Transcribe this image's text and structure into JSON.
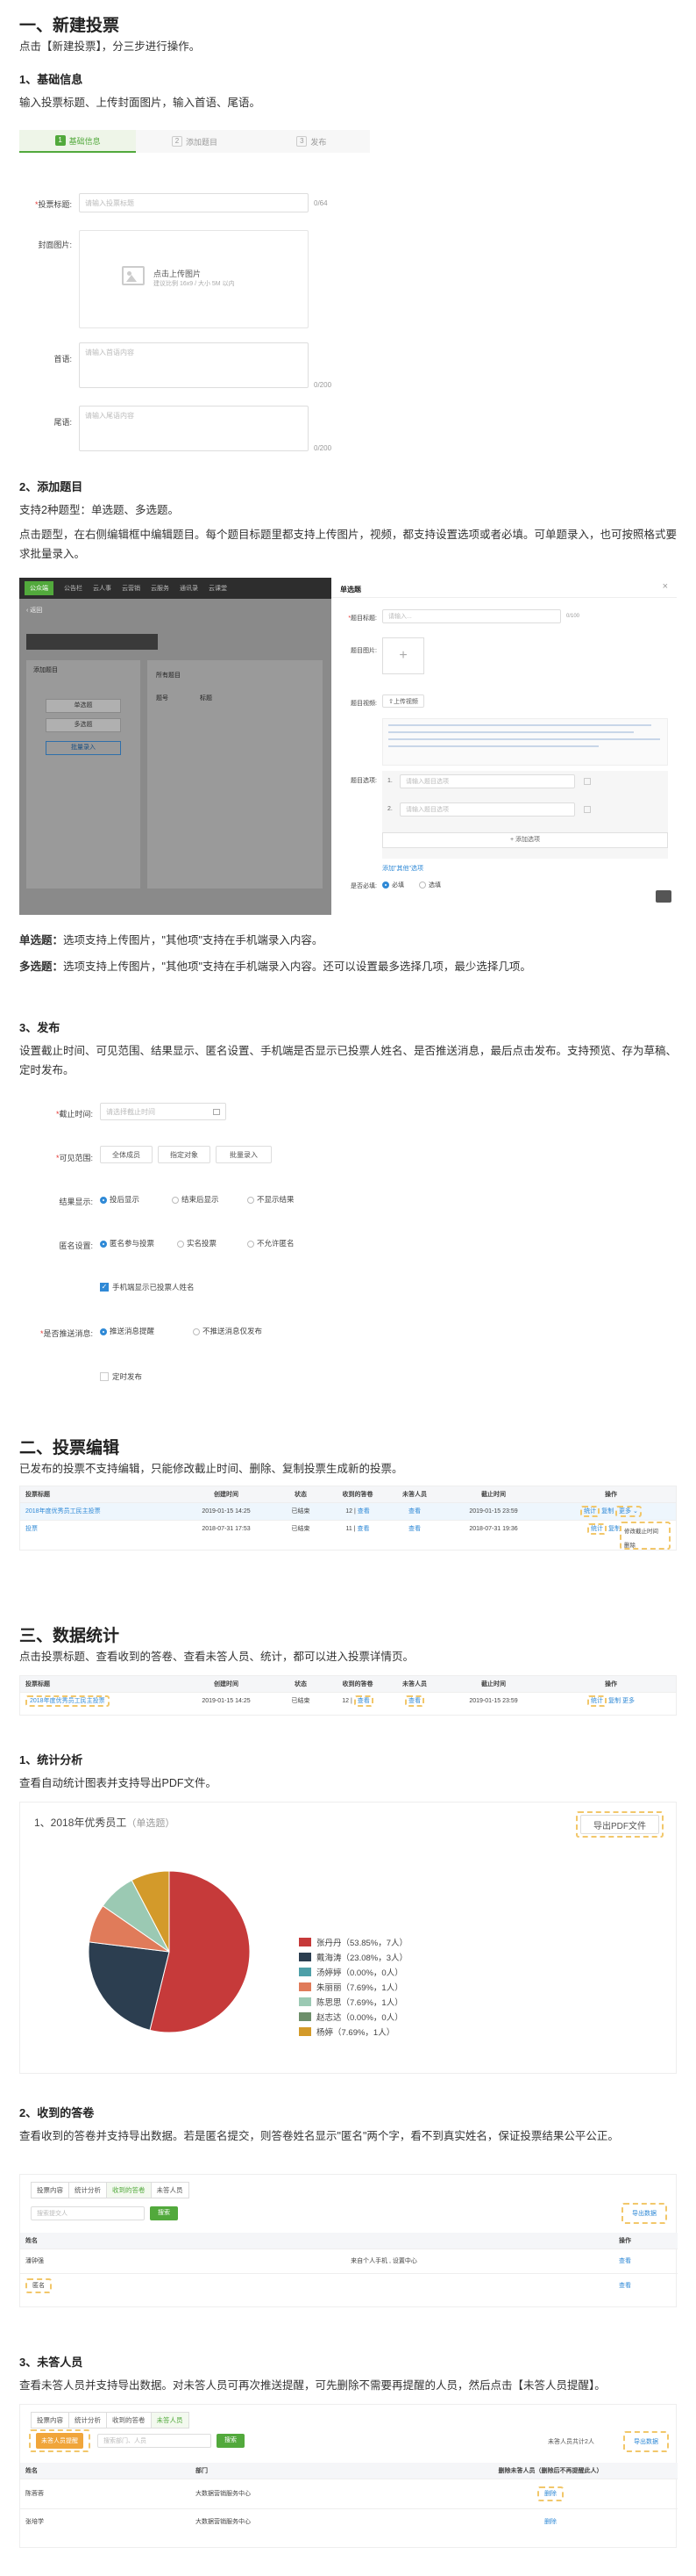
{
  "s1": {
    "title": "一、新建投票",
    "intro": "点击【新建投票】，分三步进行操作。",
    "h_basic": "1、基础信息",
    "basic_desc": "输入投票标题、上传封面图片，输入首语、尾语。",
    "steps": [
      {
        "num": "1",
        "label": "基础信息"
      },
      {
        "num": "2",
        "label": "添加题目"
      },
      {
        "num": "3",
        "label": "发布"
      }
    ],
    "form": {
      "title_label": "投票标题:",
      "title_ph": "请输入投票标题",
      "title_count": "0/64",
      "cover_label": "封面图片:",
      "upload_text": "点击上传图片",
      "upload_hint": "建议比例 16x9 / 大小 5M 以内",
      "head_label": "首语:",
      "head_ph": "请输入首语内容",
      "head_count": "0/200",
      "tail_label": "尾语:",
      "tail_ph": "请输入尾语内容",
      "tail_count": "0/200"
    },
    "h_add": "2、添加题目",
    "add_desc1": "支持2种题型：单选题、多选题。",
    "add_desc2": "点击题型，在右侧编辑框中编辑题目。每个题目标题里都支持上传图片，视频，都支持设置选项或者必填。可单题录入，也可按照格式要求批量录入。",
    "q_shot": {
      "nav": [
        "公众端",
        "公告栏",
        "云人事",
        "云营销",
        "云服务",
        "通讯录",
        "云课堂"
      ],
      "back": "返回",
      "panel_title": "添加题目",
      "types": [
        "单选题",
        "多选题"
      ],
      "batch": "批量录入",
      "list_title": "所有题目",
      "cols": [
        "题号",
        "标题"
      ],
      "modal_title": "单选题",
      "q_label": "题目标题:",
      "q_ph": "请输入...",
      "q_count": "0/100",
      "img_label": "题目图片:",
      "video_label": "题目视频:",
      "video_btn": "上传视频",
      "opt_label": "题目选项:",
      "opt1": "请输入题目选项",
      "opt2": "请输入题目选项",
      "add_opt": "+ 添加选项",
      "other": "添加\"其他\"选项",
      "req_label": "是否必填:",
      "req_yes": "必填",
      "req_no": "选填"
    },
    "single_b": "单选题：",
    "single_t": "选项支持上传图片，\"其他项\"支持在手机端录入内容。",
    "multi_b": "多选题：",
    "multi_t": "选项支持上传图片，\"其他项\"支持在手机端录入内容。还可以设置最多选择几项，最少选择几项。",
    "h_pub": "3、发布",
    "pub_desc": "设置截止时间、可见范围、结果显示、匿名设置、手机端是否显示已投票人姓名、是否推送消息，最后点击发布。支持预览、存为草稿、定时发布。",
    "pub": {
      "deadline": "截止时间:",
      "deadline_ph": "请选择截止时间",
      "scope": "可见范围:",
      "scope_opts": [
        "全体成员",
        "指定对象",
        "批量录入"
      ],
      "result": "结果显示:",
      "result_opts": [
        "投后显示",
        "结束后显示",
        "不显示结果"
      ],
      "anon": "匿名设置:",
      "anon_opts": [
        "匿名参与投票",
        "实名投票",
        "不允许匿名"
      ],
      "show_names": "手机端显示已投票人姓名",
      "push": "是否推送消息:",
      "push_opts": [
        "推送消息提醒",
        "不推送消息仅发布"
      ],
      "timed": "定时发布"
    }
  },
  "s2": {
    "title": "二、投票编辑",
    "desc": "已发布的投票不支持编辑，只能修改截止时间、删除、复制投票生成新的投票。",
    "cols": [
      "投票标题",
      "创建时间",
      "状态",
      "收到的答卷",
      "未答人员",
      "截止时间",
      "操作"
    ],
    "rows": [
      {
        "title": "2018年度优秀员工民主投票",
        "created": "2019-01-15 14:25",
        "status": "已结束",
        "count": "12",
        "view": "查看",
        "unanswered": "查看",
        "deadline": "2019-01-15 23:59",
        "ops": [
          "统计",
          "复制",
          "更多"
        ]
      },
      {
        "title": "投票",
        "created": "2018-07-31 17:53",
        "status": "已结束",
        "count": "11",
        "view": "查看",
        "unanswered": "查看",
        "deadline": "2018-07-31 19:36",
        "ops": [
          "统计",
          "复制",
          "更多"
        ]
      }
    ],
    "more_menu": [
      "修改截止时间",
      "删除"
    ]
  },
  "s3": {
    "title": "三、数据统计",
    "desc": "点击投票标题、查看收到的答卷、查看未答人员、统计，都可以进入投票详情页。",
    "row": {
      "title": "2018年度优秀员工民主投票",
      "created": "2019-01-15 14:25",
      "status": "已结束",
      "count": "12",
      "view": "查看",
      "unanswered": "查看",
      "deadline": "2019-01-15 23:59",
      "ops": [
        "统计",
        "复制",
        "更多"
      ]
    },
    "h_stat": "1、统计分析",
    "stat_desc": "查看自动统计图表并支持导出PDF文件。",
    "chart_title": "1、2018年优秀员工",
    "chart_type": "（单选题）",
    "export_pdf": "导出PDF文件",
    "h_ans": "2、收到的答卷",
    "ans_desc": "查看收到的答卷并支持导出数据。若是匿名提交，则答卷姓名显示\"匿名\"两个字，看不到真实姓名，保证投票结果公平公正。",
    "ans_tabs": [
      "投票内容",
      "统计分析",
      "收到的答卷",
      "未答人员"
    ],
    "ans_search_ph": "搜索提交人",
    "search_btn": "搜索",
    "export_data": "导出数据",
    "ans_cols": [
      "姓名",
      "",
      "操作"
    ],
    "ans_rows": [
      {
        "name": "潘钟强",
        "note": "来自个人手机 , 设置中心",
        "op": "查看"
      },
      {
        "name": "匿名",
        "note": "",
        "op": "查看"
      }
    ],
    "h_un": "3、未答人员",
    "un_desc": "查看未答人员并支持导出数据。对未答人员可再次推送提醒，可先删除不需要再提醒的人员，然后点击【未答人员提醒】。",
    "un_tabs": [
      "投票内容",
      "统计分析",
      "收到的答卷",
      "未答人员"
    ],
    "remind_btn": "未答人员提醒",
    "un_search_ph": "搜索部门、人员",
    "un_count": "未答人员共计2人",
    "un_cols": [
      "姓名",
      "部门",
      "删除未答人员（删除后不再提醒此人）"
    ],
    "un_rows": [
      {
        "name": "陈蓉蓉",
        "dept": "大数据营销服务中心",
        "op": "删除"
      },
      {
        "name": "张培学",
        "dept": "大数据营销服务中心",
        "op": "删除"
      }
    ]
  },
  "chart_data": {
    "type": "pie",
    "title": "1、2018年优秀员工",
    "categories": [
      "张丹丹",
      "戴海涛",
      "汤婷婷",
      "朱丽丽",
      "陈思思",
      "赵志达",
      "杨婷"
    ],
    "values": [
      53.85,
      23.08,
      0,
      7.69,
      7.69,
      0,
      7.69
    ],
    "labels": [
      "张丹丹（53.85%，7人）",
      "戴海涛（23.08%，3人）",
      "汤婷婷（0.00%，0人）",
      "朱丽丽（7.69%，1人）",
      "陈思思（7.69%，1人）",
      "赵志达（0.00%，0人）",
      "杨婷（7.69%，1人）"
    ],
    "colors": [
      "#c63a3a",
      "#2c3e50",
      "#4e9fa8",
      "#e07b5a",
      "#9bc9b3",
      "#6d8f6a",
      "#d39a2a"
    ]
  }
}
